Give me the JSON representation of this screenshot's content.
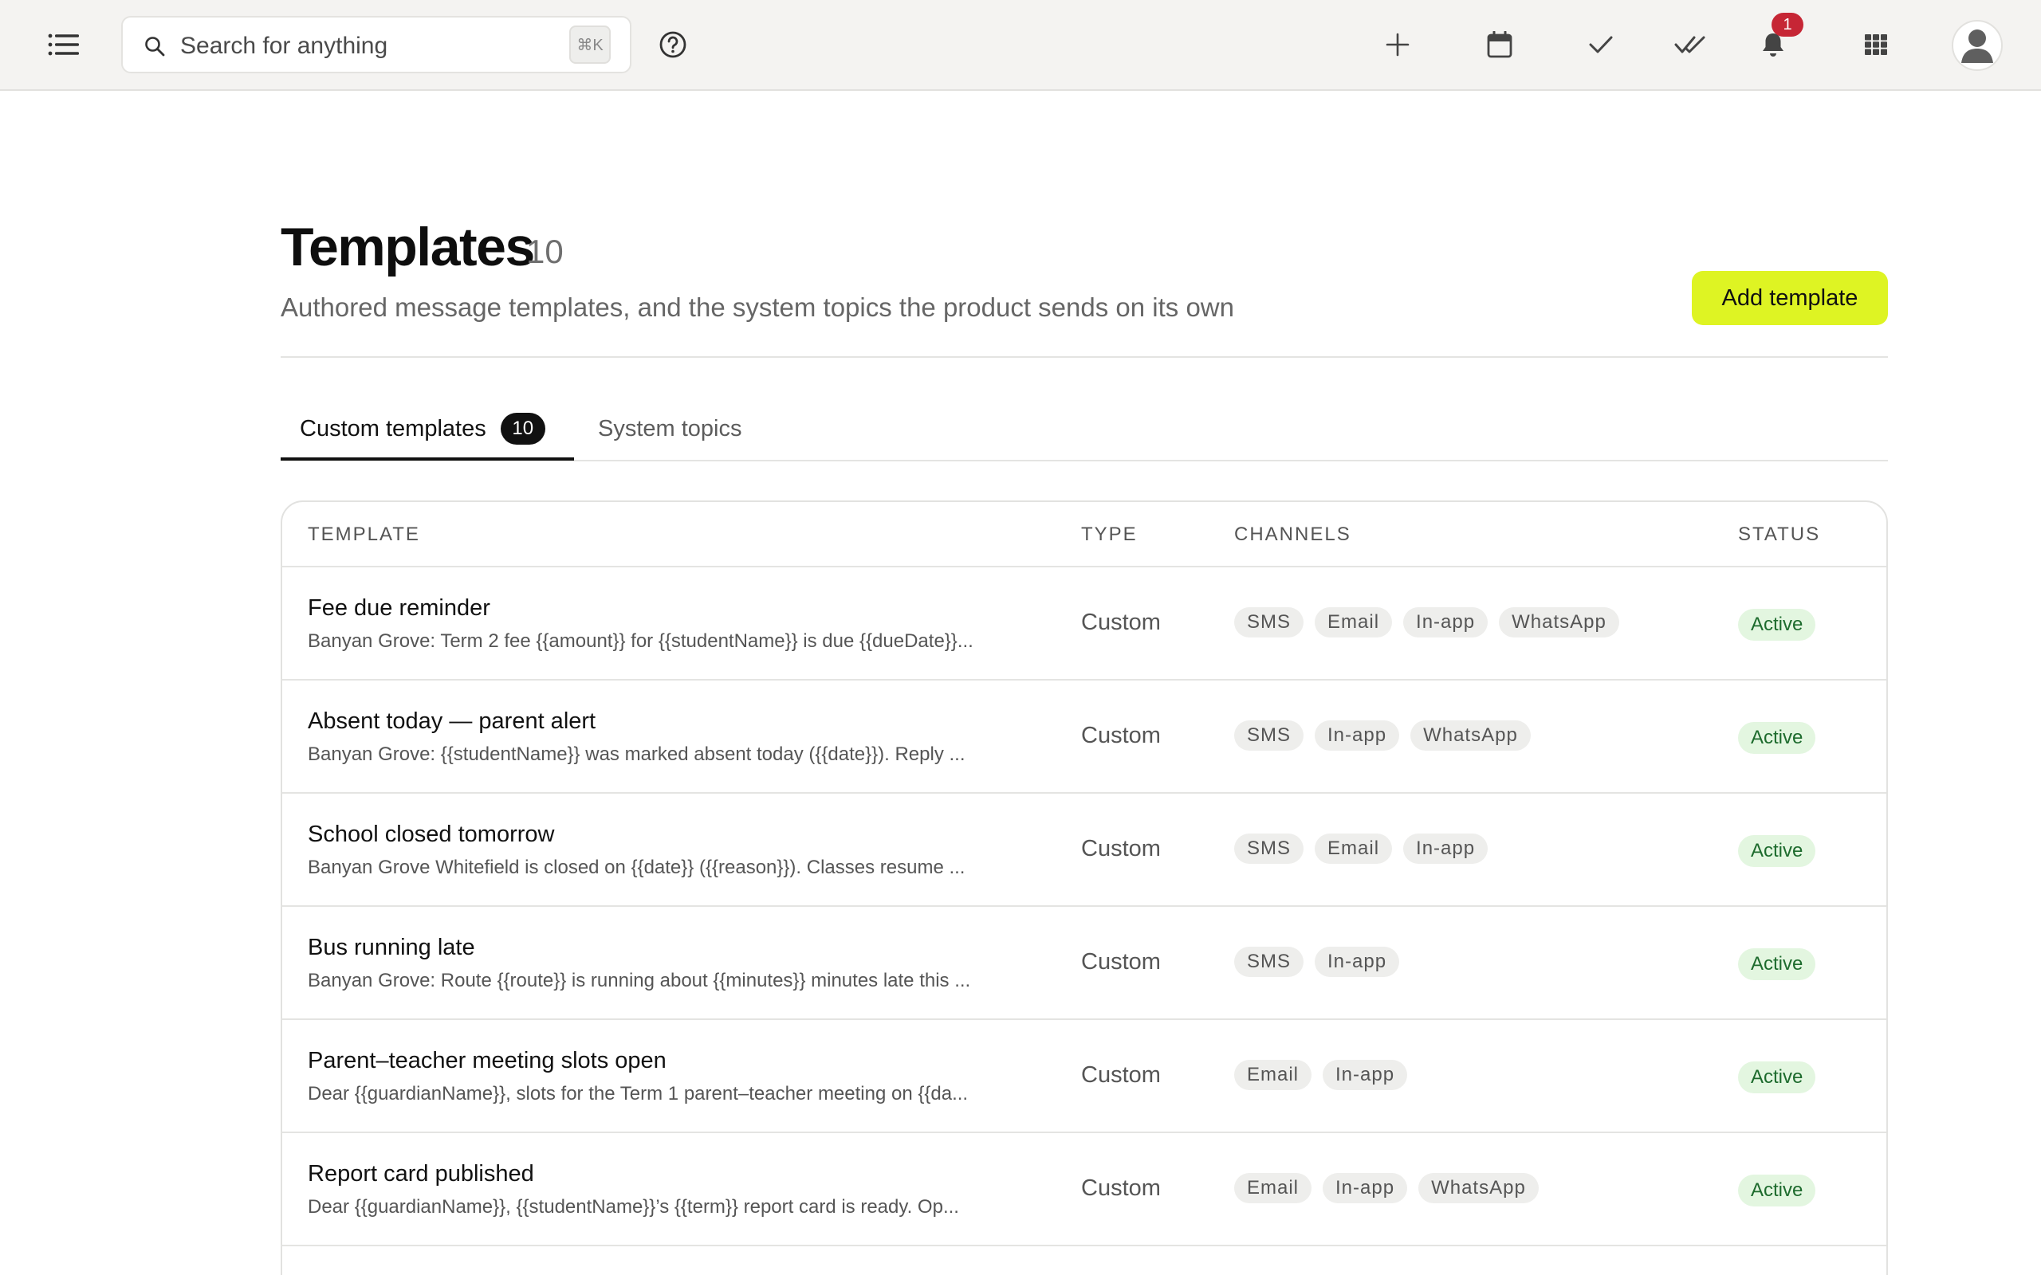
{
  "topbar": {
    "search_placeholder": "Search for anything",
    "search_shortcut": "⌘K",
    "notification_count": "1",
    "icons": [
      "menu-icon",
      "search-icon",
      "help-icon",
      "plus-icon",
      "calendar-icon",
      "check-icon",
      "double-check-icon",
      "bell-icon",
      "apps-grid-icon",
      "user-icon"
    ]
  },
  "header": {
    "title": "Templates",
    "count": "10",
    "subtitle": "Authored message templates, and the system topics the product sends on its own",
    "add_button": "Add template"
  },
  "tabs": {
    "custom_label": "Custom templates",
    "custom_count": "10",
    "system_label": "System topics"
  },
  "table": {
    "columns": [
      "TEMPLATE",
      "TYPE",
      "CHANNELS",
      "STATUS"
    ],
    "rows": [
      {
        "name": "Fee due reminder",
        "preview": "Banyan Grove: Term 2 fee {{amount}} for {{studentName}} is due {{dueDate}}...",
        "type": "Custom",
        "channels": [
          "SMS",
          "Email",
          "In-app",
          "WhatsApp"
        ],
        "status": "Active"
      },
      {
        "name": "Absent today — parent alert",
        "preview": "Banyan Grove: {{studentName}} was marked absent today ({{date}}). Reply ...",
        "type": "Custom",
        "channels": [
          "SMS",
          "In-app",
          "WhatsApp"
        ],
        "status": "Active"
      },
      {
        "name": "School closed tomorrow",
        "preview": "Banyan Grove Whitefield is closed on {{date}} ({{reason}}). Classes resume ...",
        "type": "Custom",
        "channels": [
          "SMS",
          "Email",
          "In-app"
        ],
        "status": "Active"
      },
      {
        "name": "Bus running late",
        "preview": "Banyan Grove: Route {{route}} is running about {{minutes}} minutes late this ...",
        "type": "Custom",
        "channels": [
          "SMS",
          "In-app"
        ],
        "status": "Active"
      },
      {
        "name": "Parent–teacher meeting slots open",
        "preview": "Dear {{guardianName}}, slots for the Term 1 parent–teacher meeting on {{da...",
        "type": "Custom",
        "channels": [
          "Email",
          "In-app"
        ],
        "status": "Active"
      },
      {
        "name": "Report card published",
        "preview": "Dear {{guardianName}}, {{studentName}}’s {{term}} report card is ready. Op...",
        "type": "Custom",
        "channels": [
          "Email",
          "In-app",
          "WhatsApp"
        ],
        "status": "Active"
      }
    ]
  }
}
